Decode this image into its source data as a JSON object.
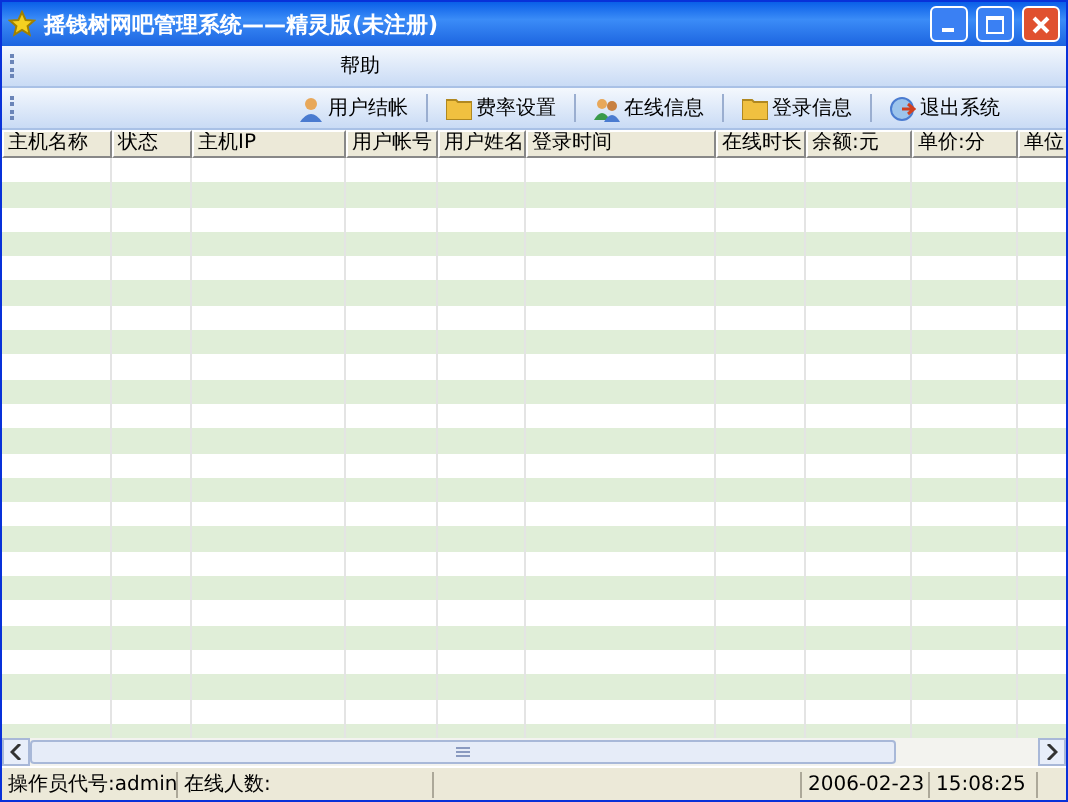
{
  "window": {
    "title": "摇钱树网吧管理系统——精灵版(未注册)"
  },
  "menu": [
    {
      "label": "帮助"
    }
  ],
  "toolbar": [
    {
      "label": "用户结帐"
    },
    {
      "label": "费率设置"
    },
    {
      "label": "在线信息"
    },
    {
      "label": "登录信息"
    },
    {
      "label": "退出系统"
    }
  ],
  "table": {
    "columns": [
      {
        "label": "主机名称"
      },
      {
        "label": "状态"
      },
      {
        "label": "主机IP"
      },
      {
        "label": "用户帐号"
      },
      {
        "label": "用户姓名"
      },
      {
        "label": "登录时间"
      },
      {
        "label": "在线时长"
      },
      {
        "label": "余额:元"
      },
      {
        "label": "单价:分"
      },
      {
        "label": "单位"
      }
    ]
  },
  "status_bar": {
    "operator": "操作员代号:admin",
    "online": "在线人数:",
    "date": "2006-02-23",
    "time": "15:08:25"
  }
}
